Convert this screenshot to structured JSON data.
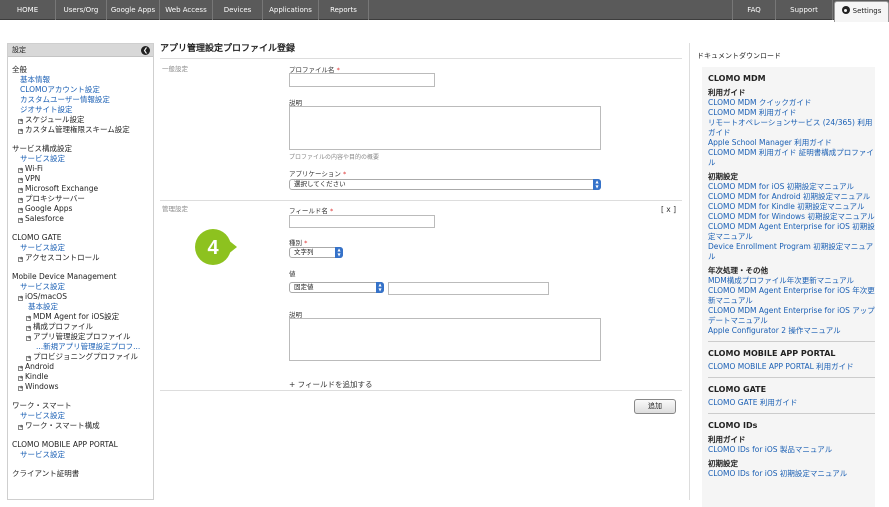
{
  "nav": {
    "tabs": [
      "HOME",
      "Users/Org",
      "Google Apps",
      "Web Access",
      "Devices",
      "Applications",
      "Reports"
    ],
    "faq": "FAQ",
    "support": "Support",
    "settings": "Settings"
  },
  "sidebar": {
    "title": "設定",
    "sections": [
      {
        "head": "全般",
        "items": [
          {
            "t": "基本情報",
            "link": true,
            "box": false,
            "indent": 1
          },
          {
            "t": "CLOMOアカウント設定",
            "link": true,
            "box": false,
            "indent": 1
          },
          {
            "t": "カスタムユーザー情報設定",
            "link": true,
            "box": false,
            "indent": 1
          },
          {
            "t": "ジオサイト設定",
            "link": true,
            "box": false,
            "indent": 1
          },
          {
            "t": "スケジュール設定",
            "link": false,
            "box": true,
            "indent": 1
          },
          {
            "t": "カスタム管理権限スキーム設定",
            "link": false,
            "box": true,
            "indent": 1
          }
        ]
      },
      {
        "head": "サービス構成設定",
        "items": [
          {
            "t": "サービス設定",
            "link": true,
            "box": false,
            "indent": 1
          },
          {
            "t": "Wi-Fi",
            "link": false,
            "box": true,
            "indent": 1
          },
          {
            "t": "VPN",
            "link": false,
            "box": true,
            "indent": 1
          },
          {
            "t": "Microsoft Exchange",
            "link": false,
            "box": true,
            "indent": 1
          },
          {
            "t": "プロキシサーバー",
            "link": false,
            "box": true,
            "indent": 1
          },
          {
            "t": "Google Apps",
            "link": false,
            "box": true,
            "indent": 1
          },
          {
            "t": "Salesforce",
            "link": false,
            "box": true,
            "indent": 1
          }
        ]
      },
      {
        "head": "CLOMO GATE",
        "items": [
          {
            "t": "サービス設定",
            "link": true,
            "box": false,
            "indent": 1
          },
          {
            "t": "アクセスコントロール",
            "link": false,
            "box": true,
            "indent": 1
          }
        ]
      },
      {
        "head": "Mobile Device Management",
        "items": [
          {
            "t": "サービス設定",
            "link": true,
            "box": false,
            "indent": 1
          },
          {
            "t": "iOS/macOS",
            "link": false,
            "box": true,
            "indent": 1
          },
          {
            "t": "基本設定",
            "link": true,
            "box": false,
            "indent": 2
          },
          {
            "t": "MDM Agent for iOS設定",
            "link": false,
            "box": true,
            "indent": 2
          },
          {
            "t": "構成プロファイル",
            "link": false,
            "box": true,
            "indent": 2
          },
          {
            "t": "アプリ管理設定プロファイル",
            "link": false,
            "box": true,
            "indent": 2
          },
          {
            "t": "...新規アプリ管理設定プロフ...",
            "link": true,
            "box": false,
            "indent": 3
          },
          {
            "t": "プロビジョニングプロファイル",
            "link": false,
            "box": true,
            "indent": 2
          },
          {
            "t": "Android",
            "link": false,
            "box": true,
            "indent": 1
          },
          {
            "t": "Kindle",
            "link": false,
            "box": true,
            "indent": 1
          },
          {
            "t": "Windows",
            "link": false,
            "box": true,
            "indent": 1
          }
        ]
      },
      {
        "head": "ワーク・スマート",
        "items": [
          {
            "t": "サービス設定",
            "link": true,
            "box": false,
            "indent": 1
          },
          {
            "t": "ワーク・スマート構成",
            "link": false,
            "box": true,
            "indent": 1
          }
        ]
      },
      {
        "head": "CLOMO MOBILE APP PORTAL",
        "items": [
          {
            "t": "サービス設定",
            "link": true,
            "box": false,
            "indent": 1
          }
        ]
      },
      {
        "head": "クライアント証明書",
        "items": []
      }
    ]
  },
  "main": {
    "title": "アプリ管理設定プロファイル登録",
    "general": {
      "section": "一般設定",
      "profile_name": "プロファイル名",
      "description": "説明",
      "desc_hint": "プロファイルの内容や目的の概要",
      "application": "アプリケーション",
      "app_select": "選択してください"
    },
    "management": {
      "section": "管理設定",
      "field_name": "フィールド名",
      "remove": "[ x ]",
      "type": "種別",
      "type_select": "文字列",
      "value": "値",
      "value_select": "固定値",
      "description": "説明",
      "add_field": "+ フィールドを追加する",
      "add_button": "追加"
    },
    "required_mark": "*",
    "badge_number": "4"
  },
  "docs": {
    "heading": "ドキュメントダウンロード",
    "groups": [
      {
        "title": "CLOMO MDM",
        "sub": [
          {
            "h": "利用ガイド",
            "links": [
              "CLOMO MDM クイックガイド",
              "CLOMO MDM 利用ガイド",
              "リモートオペレーションサービス (24/365) 利用ガイド",
              "Apple School Manager 利用ガイド",
              "CLOMO MDM 利用ガイド 証明書構成プロファイル"
            ]
          },
          {
            "h": "初期設定",
            "links": [
              "CLOMO MDM for iOS 初期設定マニュアル",
              "CLOMO MDM for Android 初期設定マニュアル",
              "CLOMO MDM for Kindle 初期設定マニュアル",
              "CLOMO MDM for Windows 初期設定マニュアル",
              "CLOMO MDM Agent Enterprise for iOS 初期設定マニュアル",
              "Device Enrollment Program 初期設定マニュアル"
            ]
          },
          {
            "h": "年次処理・その他",
            "links": [
              "MDM構成プロファイル年次更新マニュアル",
              "CLOMO MDM Agent Enterprise for iOS 年次更新マニュアル",
              "CLOMO MDM Agent Enterprise for iOS アップデートマニュアル",
              "Apple Configurator 2 操作マニュアル"
            ]
          }
        ]
      },
      {
        "title": "CLOMO MOBILE APP PORTAL",
        "sub": [
          {
            "h": "",
            "links": [
              "CLOMO MOBILE APP PORTAL 利用ガイド"
            ]
          }
        ]
      },
      {
        "title": "CLOMO GATE",
        "sub": [
          {
            "h": "",
            "links": [
              "CLOMO GATE 利用ガイド"
            ]
          }
        ]
      },
      {
        "title": "CLOMO IDs",
        "sub": [
          {
            "h": "利用ガイド",
            "links": [
              "CLOMO IDs for iOS 製品マニュアル"
            ]
          },
          {
            "h": "初期設定",
            "links": [
              "CLOMO IDs for iOS 初期設定マニュアル"
            ]
          }
        ]
      }
    ]
  }
}
